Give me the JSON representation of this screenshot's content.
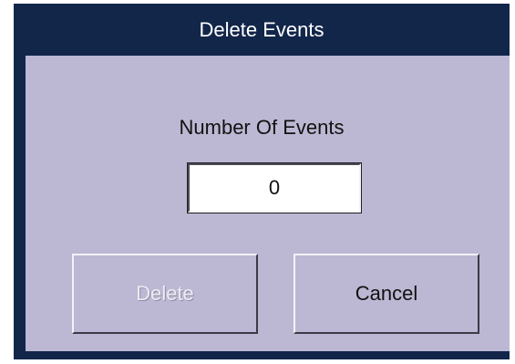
{
  "dialog": {
    "title": "Delete Events",
    "field_label": "Number Of Events",
    "field_value": "0",
    "buttons": {
      "delete_label": "Delete",
      "delete_enabled": false,
      "cancel_label": "Cancel"
    }
  },
  "colors": {
    "titlebar": "#12264a",
    "panel": "#bcb8d3",
    "field_background": "#ffffff"
  }
}
